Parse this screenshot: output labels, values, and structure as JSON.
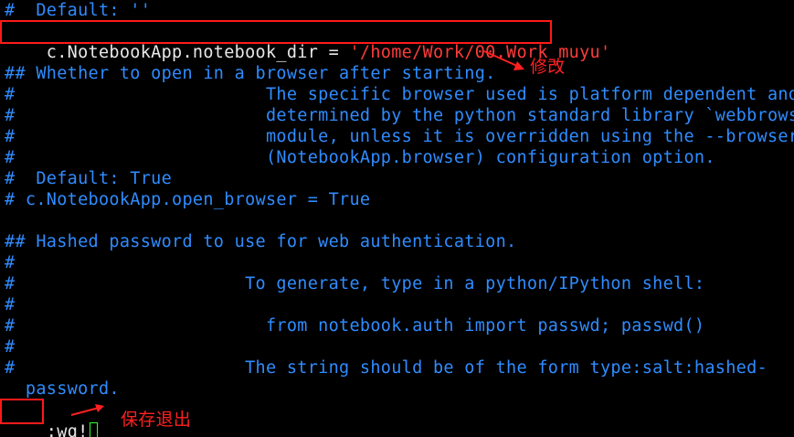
{
  "editor": {
    "lines": [
      {
        "text": "#  Default: ''",
        "color": "blue"
      },
      {
        "text": "c.NotebookApp.notebook_dir = ",
        "color": "white",
        "suffix": "'/home/Work/00.Work_muyu'",
        "suffix_color": "red"
      },
      {
        "text": "",
        "color": "blue"
      },
      {
        "text": "## Whether to open in a browser after starting.",
        "color": "blue"
      },
      {
        "text": "#                        The specific browser used is platform dependent and",
        "color": "blue"
      },
      {
        "text": "#                        determined by the python standard library `webbrowse",
        "color": "blue"
      },
      {
        "text": "#                        module, unless it is overridden using the --browser",
        "color": "blue"
      },
      {
        "text": "#                        (NotebookApp.browser) configuration option.",
        "color": "blue"
      },
      {
        "text": "#  Default: True",
        "color": "blue"
      },
      {
        "text": "# c.NotebookApp.open_browser = True",
        "color": "blue"
      },
      {
        "text": "",
        "color": "blue"
      },
      {
        "text": "## Hashed password to use for web authentication.",
        "color": "blue"
      },
      {
        "text": "#",
        "color": "blue"
      },
      {
        "text": "#                      To generate, type in a python/IPython shell:",
        "color": "blue"
      },
      {
        "text": "#",
        "color": "blue"
      },
      {
        "text": "#                        from notebook.auth import passwd; passwd()",
        "color": "blue"
      },
      {
        "text": "#",
        "color": "blue"
      },
      {
        "text": "#                      The string should be of the form type:salt:hashed-",
        "color": "blue"
      },
      {
        "text": "  password.",
        "color": "blue"
      }
    ],
    "command_line": ":wq!"
  },
  "annotations": {
    "modify_label": "修改",
    "save_quit_label": "保存退出"
  },
  "colors": {
    "comment": "#2f8cff",
    "code": "#e8e8e8",
    "string": "#ff3b3b",
    "annotation": "#ff2020",
    "cursor": "#33ff33"
  }
}
